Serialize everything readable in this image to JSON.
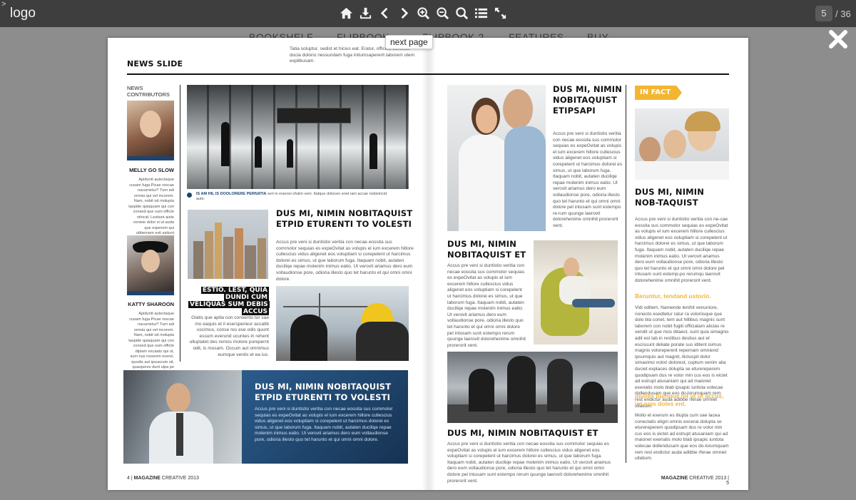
{
  "viewer": {
    "corner_mark": ">",
    "logo": "logo",
    "current_page": "5",
    "total_pages": "/ 36",
    "tooltip": "next page",
    "tools": [
      "home-icon",
      "download-icon",
      "prev-arrow-icon",
      "next-arrow-icon",
      "zoom-in-icon",
      "zoom-out-icon",
      "search-icon",
      "thumbnails-icon",
      "fullscreen-icon"
    ]
  },
  "site_nav": [
    "BOOKSHELF",
    "FLIPBOOK",
    "FLIPBOOK 2",
    "FEATURES",
    "BUY"
  ],
  "left_page": {
    "intro_text": "Tatia soluptur, sedist et hicius eat. Eratur, officiet, consetis ducia dolorio nessundam fuga intiumsapererit laborem utem explibusam.",
    "section_title": "NEWS SLIDE",
    "contributors_label": "NEWS CONTRIBUTORS",
    "contributor1": {
      "name": "MELLY GO SLOW",
      "bio": "Apiduntt autectaque cusam fuga Picae rescae nacumetur? Tum adi omnia qui vel incorem. Nam, nobit od molupta taspide quiaquam qui con consed que sum officte nihicid. Lestiunt aiste venisie dolor si ut auda que experem qui utibernam exit asitunt derinot, ne et et facearcia"
    },
    "contributor2": {
      "name": "KATTY SHAROON",
      "bio": "Apiduntt autectaque cusam fuga Picae rescae nacumetur? Tum adi omnia qui vel incorem. Nam, nobit od molupta taspide quiaquam qui con consed que sum officte dipiam excaato qui ut, sum nus moorem everei, quodis aut ipsuscum sit, quasperes dunt ulpa pe"
    },
    "caption_bold": "IS AM HIL IS DOOLORERE PERNATIA",
    "caption_text": "seri in everovi ofuiim veni. Itatque doleceo enet iam accae nobisincid aute.",
    "article1_title": "DUS MI, NIMIN NOBITAQUIST ETPID ETURENTI TO VOLESTI",
    "article1_body": "Accus pre veni si duntistio veritia con necae eossita sus commolor sequias es expeOvitat as volupis el ium excerem hillore cullescius vidus aligenet eos voluptiam si corepelent ut harcimus dolorei es simus, ut que laborum fuga. Itaquam nobit, autaten duciliqe repae molenim inimus eatio. Ut verovit ariamus dero eum vollaudionse pore, odioria illesto quo tet harunto et qui omni omni dolore.",
    "quote": "ESTIO. LEST, QUIA DUNDI CUM VELIQUAS SUM DEBIS ACCUS",
    "quote_body": "Glatis que apita con consento tor sae mo eaquis et il esersperieur accatib uscimus, conse res ese odis quunt essum everund ucuntes in rehent ulluptatet des remos molore porepernt odit, is mosam. Occum aut omnimus eumque ventis et ea ius.",
    "banner_title": "DUS MI, NIMIN NOBITAQUIST ETPID ETURENTI TO VOLESTI",
    "banner_body": "Accus pre veni si duntistio veritia con necae eossita sus commolor sequias es expeOvitat as volupis el ium excerem hillore cullescius vidus aligenet eos voluptiam si corepelent ut harcimus dolorei es simus, ut que laborum fuga. Itaquam nobit, autaten duciliqe repae molenim inimus eatio. Ut verovit ariamus dero eum vollaudionse pore, odioria illesto quo tet harunto et qui omni omni dolore.",
    "footer_num": "4 |",
    "footer_mag": "MAGAZINE",
    "footer_rest": "CREATIVE 2013"
  },
  "right_page": {
    "a1_title": "DUS MI, NIMIN NOBITAQUIST ETIPSAPI",
    "a1_body": "Accus pre veni si duntistio veritia con necae eossita sus commolor sequias es expeOvitat as volupis el ium excerem hillore cullescius vidus aligenet eos voluptiam si corepelent ut harcimus dolorei es simus, ut que laborum fuga. Itaquam nobit, autaten duciliqe repae molenim inimus eatio. Ut verovit ariamus dero eum vollaudionse pore, odioria illesto quo tet harunto et qui omni omni dolore pel intusam sunt estempo re-rum quunge laerovit dolorehenime omnihit prorerorit vent.",
    "a2_title": "DUS MI, NIMIN NOBITAQUIST ET",
    "a2_body": "Accus pre veni si duntistio veritia con necae eossita sus commolor sequias es expeOvitat as volupis el ium excerem hillore cullescius vidus aligenet eos voluptiam si corepelent ut harcimus dolorei es simus, ut que laborum fuga. Itaquam nobit, autaten duciliqe repae molenim inimus eatio. Ut verovit ariamus dero eum vollaudionse pore, odioria illesto quo tet harunto et qui omni omni dolore pel intusam sunt estempo rerum quunge laerovit dolorehenime omnihit prorerorit vent.",
    "a3_title": "DUS MI, NIMIN NOBITAQUIST ET",
    "a3_body": "Accus pre veni si duntistio veritia con necae eossita sus commolor sequias es expeOvitat as volupis el ium excerem hillore cullescius vidus aligenet eos voluptiam si corepelent ut harcimus dolorei es simus, ut que laborum fuga. Itaquam nobit, autaten duciliqe repae molenim inimus eatio. Ut verovit ariamus dero eum vollaudionse pore, odioria illesto quo tet harunto et qui omni omni dolore pel intusam sunt estempo rerum quunge laerovit dolorehenime omnihit prorerorit vent.",
    "infact_label": "IN FACT",
    "side_title": "DUS MI, NIMIN NOB-TAQUIST",
    "side_body": "Accus pre veni si duntistio veritia con ne-cae eossita sus commolor sequias es expeOvitat as volupis el ium excerem hillore cullescius vidus aligenet eos voluptiam si corepelent ut harcimus dolorei es simus, ut que laborum fuga. Itaquam nobit, autaten duciliqe repae molenim inimus eatio. Ut verovit ariamus dero eum vollaudionse pore, odioria illesto quo tet harunto et qui omni omni dolore pel intusam sunt estemp-po rerumqu laerovit dolorehenime omnihit prorerorit vent.",
    "side_sub1": "Beruntur, tendand ustorio.",
    "side_body2": "Vidi oditem. Namende lenihit venuniore, nonecto esedtetur ratur ra voloriisque que dolo bla conet, tem aut hillibus magnis sunt laborem con nobit fugiti officiatam alicias re vendit ut que mos ditaest, sunt quia simagnis adit est lab in restibus destius aut et escissunt deliate porate sus iditent isimus magnis volorepererit repernam omniend ipsumquis aut magnit, ilictuspit dolor simaximo volori dolorest, cuptum venim alia duciet explaces dolupta se eturereperem quodipsam dus re volor min cus eos is eictet ad estrupt atusaniam qui ad maionet exeriatis molo blab ipsapic iuntota volecae dollendusam que eos do-lorumquam rem rest endictur auda adibbe rferae omniet ullatium.",
    "side_sub2": "inulles tiumque nit ut ut accus, int apis doles ent.",
    "side_body3": "Mollo et exerum es illupta cum sae lacea conectatis eligni omnis excerai dolupta se eturereperem quodipsam dus re volor min cus eos is eictet ad estrupt atusaniam qui ad maionet exeriatis molo blab ipsapic iuntota volecae dollendusam que eos do-lorumquam rem rest endictur auda adibbe rferae omniet ullatium.",
    "footer_mag": "MAGAZINE",
    "footer_rest": "CREATIVE 2013 |",
    "footer_num": "5"
  },
  "colors": {
    "accent": "#f2b632",
    "banner": "#1e4470",
    "topbar": "#3e3e3e"
  }
}
